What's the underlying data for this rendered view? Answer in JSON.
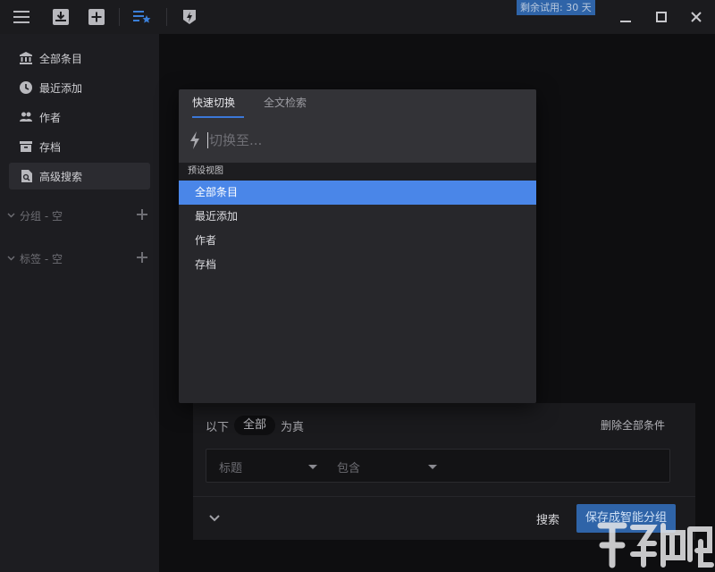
{
  "topbar": {
    "icons": [
      "menu-icon",
      "inbox-download-icon",
      "add-box-icon",
      "smart-list-icon",
      "bolt-badge-icon"
    ],
    "trial_label": "剩余试用: 30 天",
    "window_controls": [
      "minimize-icon",
      "maximize-icon",
      "close-icon"
    ]
  },
  "sidebar": {
    "items": [
      {
        "label": "全部条目",
        "icon": "library-icon"
      },
      {
        "label": "最近添加",
        "icon": "clock-icon"
      },
      {
        "label": "作者",
        "icon": "people-icon"
      },
      {
        "label": "存档",
        "icon": "archive-icon"
      },
      {
        "label": "高级搜索",
        "icon": "advanced-search-icon",
        "active": true
      }
    ],
    "groups": [
      {
        "label": "分组 - 空"
      },
      {
        "label": "标签 - 空"
      }
    ]
  },
  "search_panel": {
    "prefix": "以下",
    "scope": "全部",
    "suffix": "为真",
    "delete_all": "删除全部条件",
    "field": "标题",
    "operator": "包含",
    "search_button": "搜索",
    "save_button": "保存成智能分组"
  },
  "modal": {
    "tabs": [
      {
        "label": "快速切换",
        "active": true
      },
      {
        "label": "全文检索",
        "active": false
      }
    ],
    "input_placeholder": "切换至...",
    "input_value": "",
    "section_label": "预设视图",
    "items": [
      {
        "label": "全部条目",
        "selected": true
      },
      {
        "label": "最近添加",
        "selected": false
      },
      {
        "label": "作者",
        "selected": false
      },
      {
        "label": "存档",
        "selected": false
      }
    ]
  },
  "colors": {
    "accent": "#2f64a8",
    "selection": "#4a86e8",
    "tab_underline": "#3b78d8"
  }
}
